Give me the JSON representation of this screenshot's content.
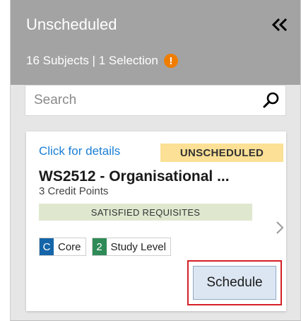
{
  "panel": {
    "title": "Unscheduled",
    "collapse_icon": "double-chevron-left-icon",
    "subtitle": "16 Subjects | 1 Selection",
    "warning_glyph": "!",
    "warning_color": "#ef7d00"
  },
  "search": {
    "placeholder": "Search",
    "value": "",
    "icon": "search-icon"
  },
  "card": {
    "details_link": "Click for details",
    "status": "UNSCHEDULED",
    "title": "WS2512 - Organisational ...",
    "credits": "3 Credit Points",
    "requisites": "SATISFIED REQUISITES",
    "tags": [
      {
        "code": "C",
        "label": "Core",
        "color": "#1565a8"
      },
      {
        "code": "2",
        "label": "Study Level",
        "color": "#2e8b57"
      }
    ],
    "schedule_label": "Schedule",
    "highlight_color": "#d32027"
  }
}
